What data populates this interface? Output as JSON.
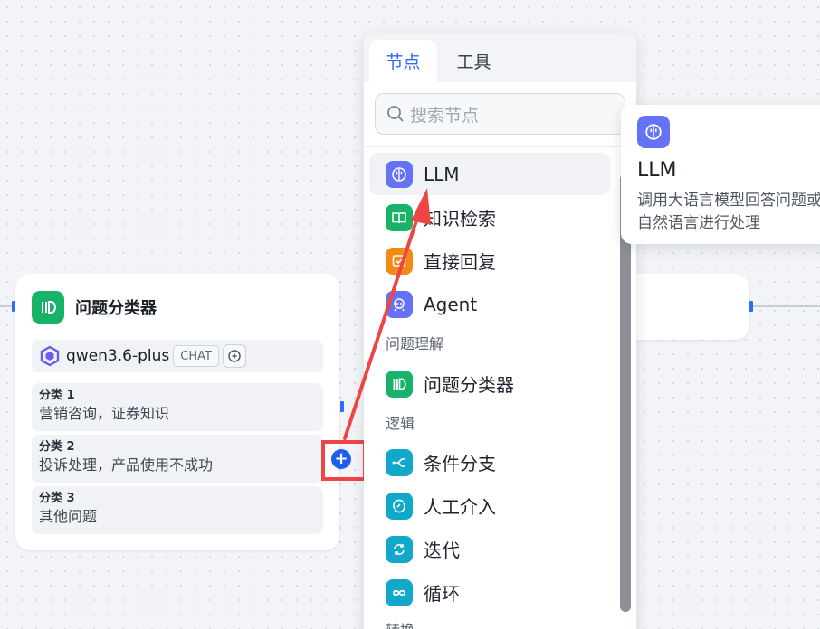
{
  "classifier_node": {
    "title": "问题分类器",
    "model": {
      "name": "qwen3.6-plus",
      "mode_badge": "CHAT"
    },
    "classes": [
      {
        "title": "分类 1",
        "description": "营销咨询，证券知识"
      },
      {
        "title": "分类 2",
        "description": "投诉处理，产品使用不成功"
      },
      {
        "title": "分类 3",
        "description": "其他问题"
      }
    ]
  },
  "add_button": {
    "label": "+"
  },
  "node_panel": {
    "tabs": [
      {
        "label": "节点",
        "active": true
      },
      {
        "label": "工具",
        "active": false
      }
    ],
    "search": {
      "placeholder": "搜索节点"
    },
    "groups": [
      {
        "title": "",
        "items": [
          {
            "label": "LLM",
            "icon": "brain-icon",
            "color": "#6672f5",
            "selected": true
          },
          {
            "label": "知识检索",
            "icon": "book-icon",
            "color": "#18b368"
          },
          {
            "label": "直接回复",
            "icon": "reply-icon",
            "color": "#f38a16"
          },
          {
            "label": "Agent",
            "icon": "agent-icon",
            "color": "#6672f5"
          }
        ]
      },
      {
        "title": "问题理解",
        "items": [
          {
            "label": "问题分类器",
            "icon": "classifier-icon",
            "color": "#18b368"
          }
        ]
      },
      {
        "title": "逻辑",
        "items": [
          {
            "label": "条件分支",
            "icon": "branch-icon",
            "color": "#11a8c9"
          },
          {
            "label": "人工介入",
            "icon": "human-icon",
            "color": "#11a8c9"
          },
          {
            "label": "迭代",
            "icon": "iteration-icon",
            "color": "#11a8c9"
          },
          {
            "label": "循环",
            "icon": "loop-icon",
            "color": "#11a8c9"
          }
        ]
      },
      {
        "title": "转换",
        "items": []
      }
    ]
  },
  "tooltip": {
    "title": "LLM",
    "description": "调用大语言模型回答问题或者对自然语言进行处理"
  },
  "colors": {
    "accent": "#2f6bff",
    "annotation": "#ee4646"
  }
}
